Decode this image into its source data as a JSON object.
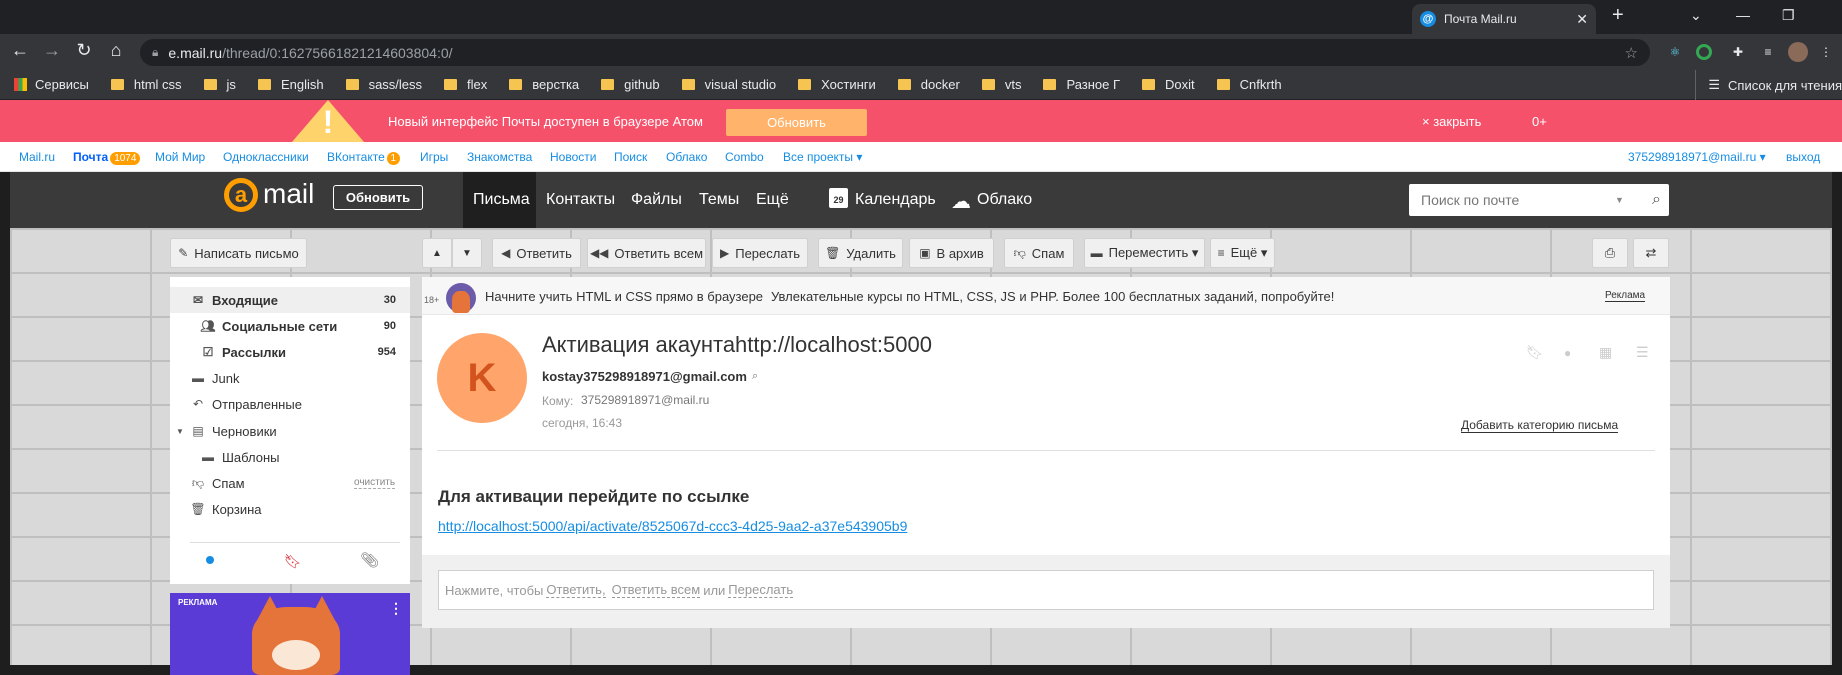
{
  "browser": {
    "tab_title": "Почта Mail.ru",
    "tab_favicon": "@",
    "url_host": "e.mail.ru",
    "url_path": "/thread/0:16275661821214603804:0/",
    "bookmarks": [
      "Сервисы",
      "html css",
      "js",
      "English",
      "sass/less",
      "flex",
      "верстка",
      "github",
      "visual studio",
      "Хостинги",
      "docker",
      "vts",
      "Разное Г",
      "Doxit",
      "Cnfkrth"
    ],
    "reading_list": "Список для чтения"
  },
  "promo": {
    "text": "Новый интерфейс Почты доступен в браузере Атом",
    "button": "Обновить",
    "close": "× закрыть",
    "count": "0+"
  },
  "portal": {
    "mailru": "Mail.ru",
    "pochta": "Почта",
    "pochta_badge": "1074",
    "moimir": "Мой Мир",
    "ok": "Одноклассники",
    "vk": "ВКонтакте",
    "vk_badge": "1",
    "games": "Игры",
    "dating": "Знакомства",
    "news": "Новости",
    "search": "Поиск",
    "cloud": "Облако",
    "combo": "Combo",
    "all": "Все проекты ▾",
    "account": "375298918971@mail.ru ▾",
    "exit": "выход"
  },
  "header": {
    "logo": "mail",
    "update": "Обновить",
    "nav": [
      "Письма",
      "Контакты",
      "Файлы",
      "Темы",
      "Ещё"
    ],
    "calendar_day": "29",
    "calendar": "Календарь",
    "cloud": "Облако",
    "search_placeholder": "Поиск по почте"
  },
  "toolbar": {
    "compose": "Написать письмо",
    "reply": "Ответить",
    "reply_all": "Ответить всем",
    "forward": "Переслать",
    "delete": "Удалить",
    "archive": "В архив",
    "spam": "Спам",
    "move": "Переместить ▾",
    "more": "Ещё ▾"
  },
  "folders": [
    {
      "name": "Входящие",
      "count": "30"
    },
    {
      "name": "Социальные сети",
      "count": "90"
    },
    {
      "name": "Рассылки",
      "count": "954"
    },
    {
      "name": "Junk",
      "count": ""
    },
    {
      "name": "Отправленные",
      "count": ""
    },
    {
      "name": "Черновики",
      "count": ""
    },
    {
      "name": "Шаблоны",
      "count": ""
    },
    {
      "name": "Спам",
      "count": ""
    },
    {
      "name": "Корзина",
      "count": ""
    }
  ],
  "clean_label": "очистить",
  "ad_label": "РЕКЛАМА",
  "adbar": {
    "age": "18+",
    "title": "Начните учить HTML и CSS прямо в браузере",
    "text": "Увлекательные курсы по HTML, CSS, JS и PHP. Более 100 бесплатных заданий, попробуйте!",
    "mark": "Реклама"
  },
  "message": {
    "avatar_letter": "K",
    "subject": "Активация акаунтаhttp://localhost:5000",
    "from": "kostay375298918971@gmail.com",
    "to_label": "Кому:",
    "to": "375298918971@mail.ru",
    "date": "сегодня, 16:43",
    "add_category": "Добавить категорию письма",
    "body_heading": "Для активации перейдите по ссылке",
    "body_link": "http://localhost:5000/api/activate/8525067d-ccc3-4d25-9aa2-a37e543905b9"
  },
  "reply": {
    "prefix": "Нажмите, чтобы",
    "reply": "Ответить,",
    "reply_all": "Ответить всем",
    "or": "или",
    "forward": "Переслать"
  }
}
